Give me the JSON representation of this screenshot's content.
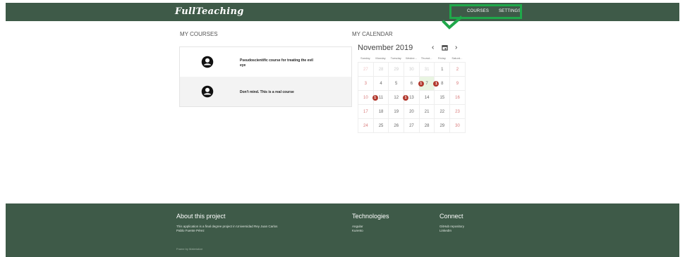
{
  "app": {
    "logo": "FullTeaching"
  },
  "nav": {
    "courses": "COURSES",
    "settings": "SETTINGS"
  },
  "courses": {
    "title": "MY COURSES",
    "items": [
      {
        "name": "Pseudoscientific course for treating the evil eye"
      },
      {
        "name": "Don't mind. This is a real course"
      }
    ]
  },
  "calendar": {
    "title": "MY CALENDAR",
    "month_label": "November 2019",
    "prev_icon": "chevron-left-icon",
    "today_icon": "calendar-icon",
    "next_icon": "chevron-right-icon",
    "weekdays": [
      "Sunday",
      "Monday",
      "Tuesday",
      "Wedne...",
      "Thursd...",
      "Friday",
      "Saturd..."
    ],
    "weeks": [
      [
        {
          "d": "27",
          "o": 1
        },
        {
          "d": "28",
          "o": 1
        },
        {
          "d": "29",
          "o": 1
        },
        {
          "d": "30",
          "o": 1
        },
        {
          "d": "31",
          "o": 1
        },
        {
          "d": "1"
        },
        {
          "d": "2"
        }
      ],
      [
        {
          "d": "3"
        },
        {
          "d": "4"
        },
        {
          "d": "5"
        },
        {
          "d": "6"
        },
        {
          "d": "7",
          "today": 1,
          "badge": "1"
        },
        {
          "d": "8",
          "badge": "1"
        },
        {
          "d": "9"
        }
      ],
      [
        {
          "d": "10"
        },
        {
          "d": "11",
          "badge": "1"
        },
        {
          "d": "12"
        },
        {
          "d": "13",
          "badge": "1"
        },
        {
          "d": "14"
        },
        {
          "d": "15"
        },
        {
          "d": "16"
        }
      ],
      [
        {
          "d": "17"
        },
        {
          "d": "18"
        },
        {
          "d": "19"
        },
        {
          "d": "20"
        },
        {
          "d": "21"
        },
        {
          "d": "22"
        },
        {
          "d": "23"
        }
      ],
      [
        {
          "d": "24"
        },
        {
          "d": "25"
        },
        {
          "d": "26"
        },
        {
          "d": "27"
        },
        {
          "d": "28"
        },
        {
          "d": "29"
        },
        {
          "d": "30"
        }
      ]
    ]
  },
  "footer": {
    "about_title": "About this project",
    "about_text1": "This application is a final degree project in Universidad Rey Juan Carlos",
    "about_text2": "Pablo Fuente Pérez",
    "tech_title": "Technologies",
    "tech_items": [
      "Angular",
      "Kurento"
    ],
    "connect_title": "Connect",
    "connect_items": [
      "GitHub repository",
      "LinkedIn"
    ],
    "frame_text": "Frame by Materialize"
  }
}
